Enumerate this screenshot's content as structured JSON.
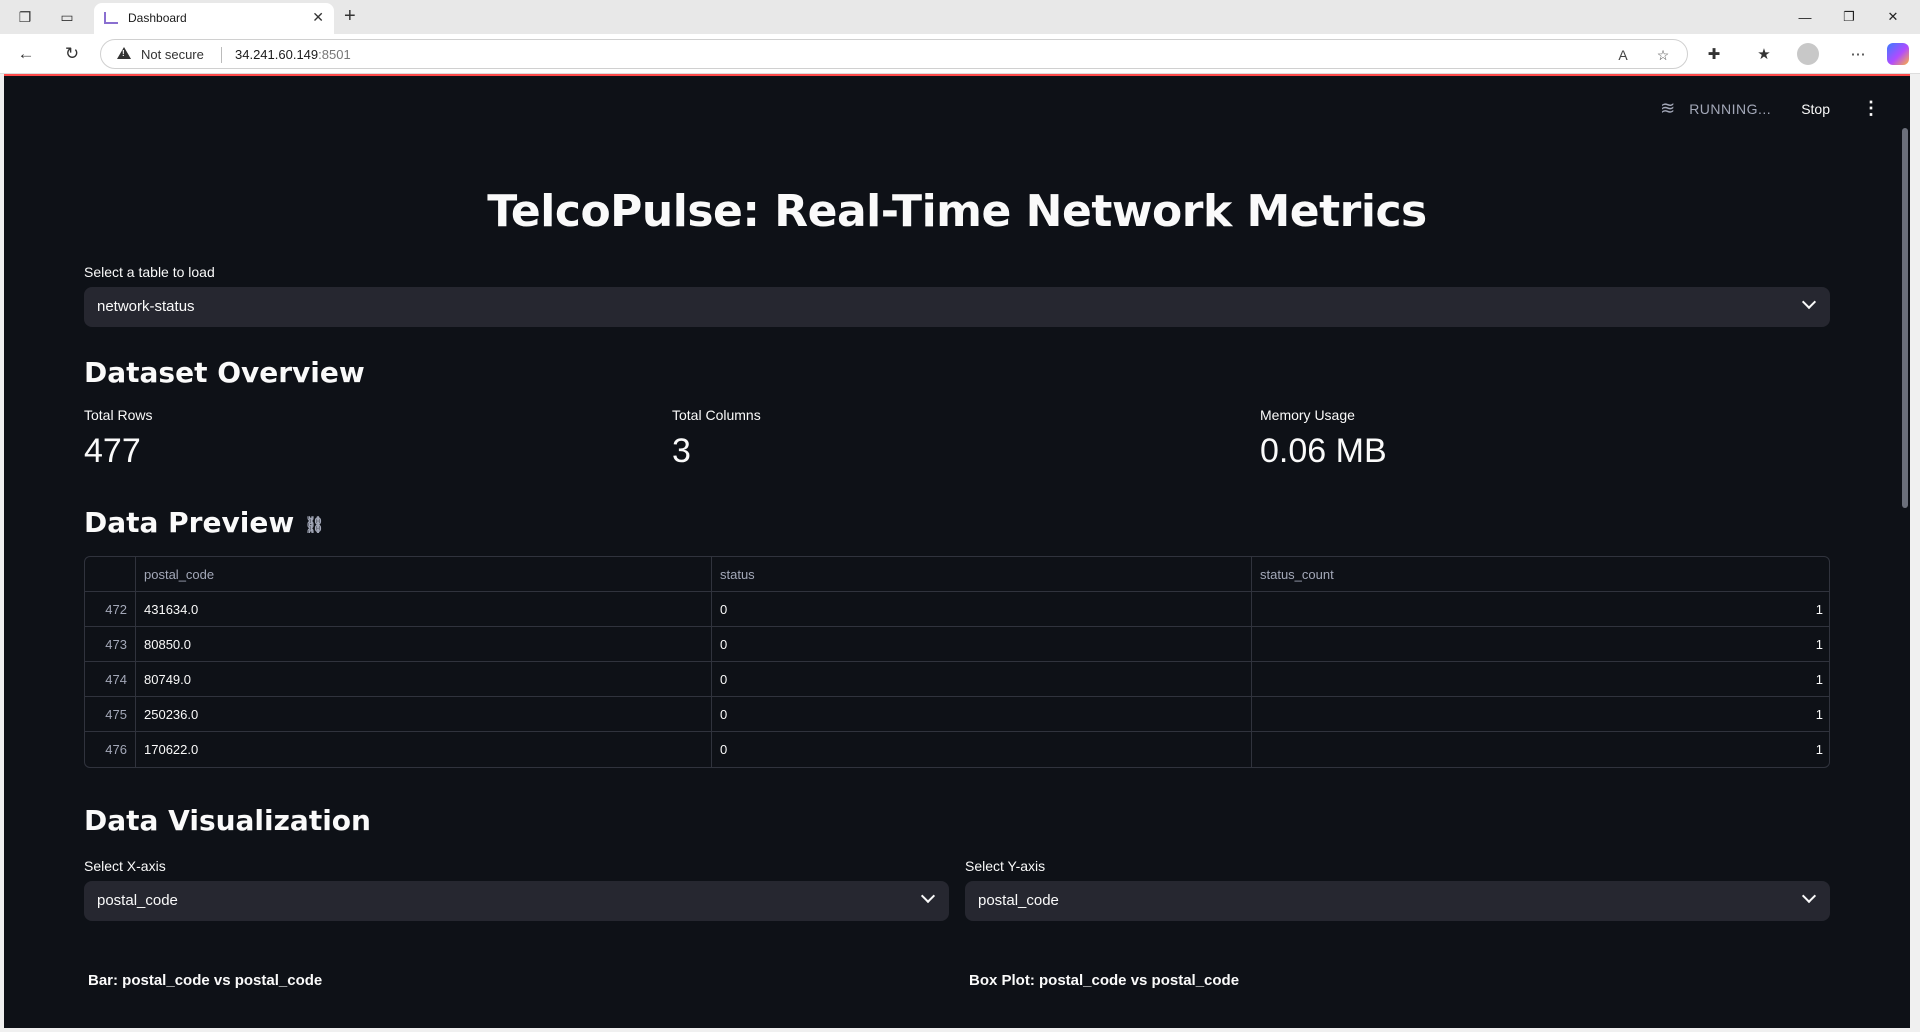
{
  "browser": {
    "tab_title": "Dashboard",
    "not_secure": "Not secure",
    "url_host": "34.241.60.149",
    "url_port": ":8501"
  },
  "app": {
    "status_text": "RUNNING...",
    "stop_label": "Stop",
    "title": "TelcoPulse: Real-Time Network Metrics",
    "table_select": {
      "label": "Select a table to load",
      "value": "network-status"
    },
    "overview": {
      "heading": "Dataset Overview",
      "metrics": [
        {
          "label": "Total Rows",
          "value": "477"
        },
        {
          "label": "Total Columns",
          "value": "3"
        },
        {
          "label": "Memory Usage",
          "value": "0.06 MB"
        }
      ]
    },
    "preview": {
      "heading": "Data Preview",
      "columns": [
        "postal_code",
        "status",
        "status_count"
      ],
      "rows": [
        {
          "idx": "472",
          "postal_code": "431634.0",
          "status": "0",
          "status_count": "1"
        },
        {
          "idx": "473",
          "postal_code": "80850.0",
          "status": "0",
          "status_count": "1"
        },
        {
          "idx": "474",
          "postal_code": "80749.0",
          "status": "0",
          "status_count": "1"
        },
        {
          "idx": "475",
          "postal_code": "250236.0",
          "status": "0",
          "status_count": "1"
        },
        {
          "idx": "476",
          "postal_code": "170622.0",
          "status": "0",
          "status_count": "1"
        }
      ]
    },
    "visualization": {
      "heading": "Data Visualization",
      "x_select": {
        "label": "Select X-axis",
        "value": "postal_code"
      },
      "y_select": {
        "label": "Select Y-axis",
        "value": "postal_code"
      },
      "bar_title": "Bar: postal_code vs postal_code",
      "box_title": "Box Plot: postal_code vs postal_code"
    }
  }
}
